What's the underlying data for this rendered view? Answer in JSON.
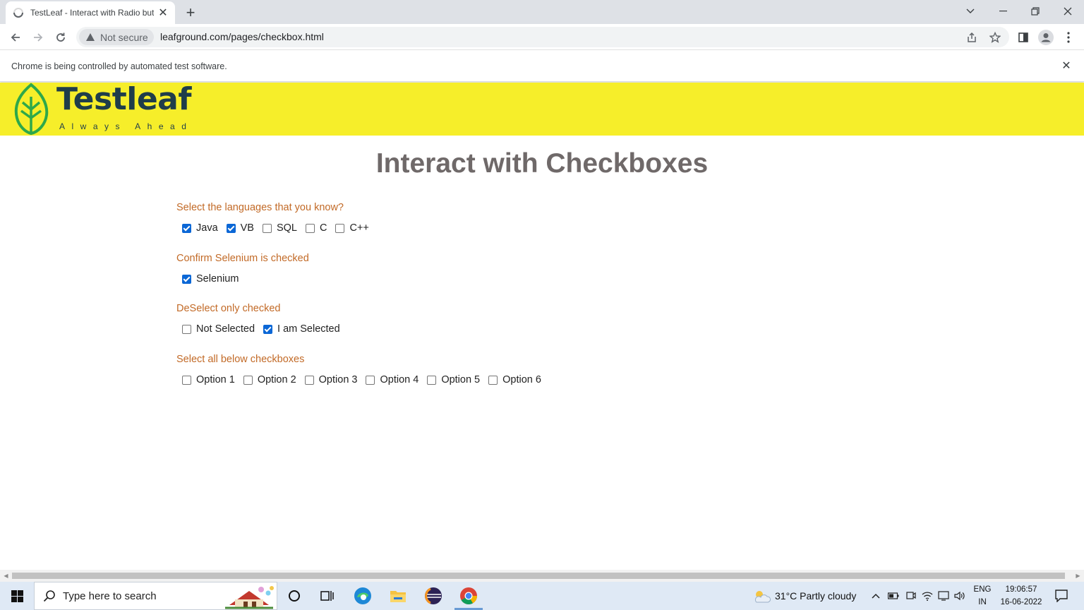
{
  "browser": {
    "tab_title": "TestLeaf - Interact with Radio buttons",
    "new_tab_symbol": "+",
    "tab_close_symbol": "✕",
    "security_label": "Not secure",
    "url": "leafground.com/pages/checkbox.html",
    "infobar_text": "Chrome is being controlled by automated test software.",
    "infobar_close": "✕"
  },
  "site": {
    "logo_name": "Testleaf",
    "logo_tagline": "Always Ahead",
    "header_color": "#f6ee2a",
    "title": "Interact with Checkboxes"
  },
  "sections": [
    {
      "label": "Select the languages that you know?",
      "options": [
        {
          "label": "Java",
          "checked": true
        },
        {
          "label": "VB",
          "checked": true
        },
        {
          "label": "SQL",
          "checked": false
        },
        {
          "label": "C",
          "checked": false
        },
        {
          "label": "C++",
          "checked": false
        }
      ]
    },
    {
      "label": "Confirm Selenium is checked",
      "options": [
        {
          "label": "Selenium",
          "checked": true
        }
      ]
    },
    {
      "label": "DeSelect only checked",
      "options": [
        {
          "label": "Not Selected",
          "checked": false
        },
        {
          "label": "I am Selected",
          "checked": true
        }
      ]
    },
    {
      "label": "Select all below checkboxes",
      "options": [
        {
          "label": "Option 1",
          "checked": false
        },
        {
          "label": "Option 2",
          "checked": false
        },
        {
          "label": "Option 3",
          "checked": false
        },
        {
          "label": "Option 4",
          "checked": false
        },
        {
          "label": "Option 5",
          "checked": false
        },
        {
          "label": "Option 6",
          "checked": false
        }
      ]
    }
  ],
  "taskbar": {
    "search_placeholder": "Type here to search",
    "weather": "31°C  Partly cloudy",
    "lang_top": "ENG",
    "lang_bottom": "IN",
    "time": "19:06:57",
    "date": "16-06-2022"
  }
}
